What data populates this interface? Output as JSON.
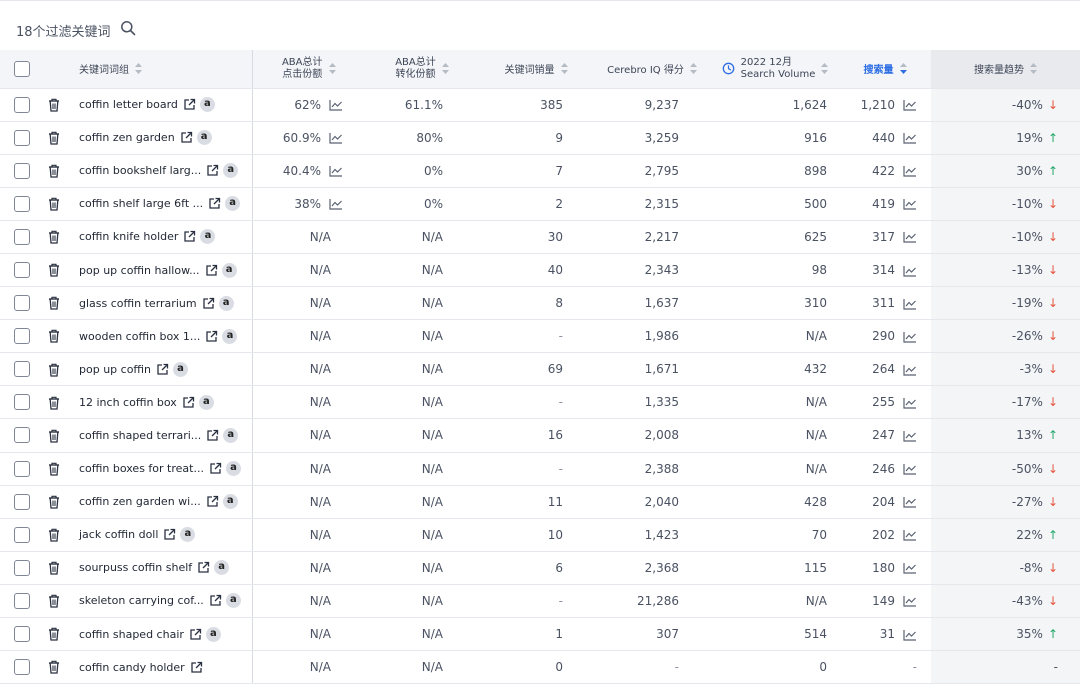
{
  "toolbar": {
    "filter_count_label": "18个过滤关键词"
  },
  "header": {
    "keyword_phrase": "关键词词组",
    "aba_click_line1": "ABA总计",
    "aba_click_line2": "点击份额",
    "aba_conv_line1": "ABA总计",
    "aba_conv_line2": "转化份额",
    "keyword_sales": "关键词销量",
    "cerebro_iq": "Cerebro IQ 得分",
    "sv_line1": "2022 12月",
    "sv_line2": "Search Volume",
    "search_volume": "搜索量",
    "search_trend": "搜索量趋势"
  },
  "colors": {
    "accent": "#2f6fe4",
    "trend_down": "#e5533d",
    "trend_up": "#22a86b",
    "trend_column_bg": "#f4f5f7"
  },
  "rows": [
    {
      "keyword": "coffin letter board",
      "amazon": "a",
      "aba_click": "62%",
      "aba_click_chart": true,
      "aba_conv": "61.1%",
      "sales": "385",
      "iq": "9,237",
      "sv_dec": "1,624",
      "search": "1,210",
      "trend": "-40%",
      "dir": "down"
    },
    {
      "keyword": "coffin zen garden",
      "amazon": "a",
      "aba_click": "60.9%",
      "aba_click_chart": true,
      "aba_conv": "80%",
      "sales": "9",
      "iq": "3,259",
      "sv_dec": "916",
      "search": "440",
      "trend": "19%",
      "dir": "up"
    },
    {
      "keyword": "coffin bookshelf larg...",
      "amazon": "a",
      "aba_click": "40.4%",
      "aba_click_chart": true,
      "aba_conv": "0%",
      "sales": "7",
      "iq": "2,795",
      "sv_dec": "898",
      "search": "422",
      "trend": "30%",
      "dir": "up"
    },
    {
      "keyword": "coffin shelf large 6ft ...",
      "amazon": "a",
      "aba_click": "38%",
      "aba_click_chart": true,
      "aba_conv": "0%",
      "sales": "2",
      "iq": "2,315",
      "sv_dec": "500",
      "search": "419",
      "trend": "-10%",
      "dir": "down"
    },
    {
      "keyword": "coffin knife holder",
      "amazon": "a",
      "aba_click": "N/A",
      "aba_click_chart": false,
      "aba_conv": "N/A",
      "sales": "30",
      "iq": "2,217",
      "sv_dec": "625",
      "search": "317",
      "trend": "-10%",
      "dir": "down"
    },
    {
      "keyword": "pop up coffin hallow...",
      "amazon": "a",
      "aba_click": "N/A",
      "aba_click_chart": false,
      "aba_conv": "N/A",
      "sales": "40",
      "iq": "2,343",
      "sv_dec": "98",
      "search": "314",
      "trend": "-13%",
      "dir": "down"
    },
    {
      "keyword": "glass coffin terrarium",
      "amazon": "a",
      "aba_click": "N/A",
      "aba_click_chart": false,
      "aba_conv": "N/A",
      "sales": "8",
      "iq": "1,637",
      "sv_dec": "310",
      "search": "311",
      "trend": "-19%",
      "dir": "down"
    },
    {
      "keyword": "wooden coffin box 1...",
      "amazon": "a",
      "aba_click": "N/A",
      "aba_click_chart": false,
      "aba_conv": "N/A",
      "sales": "-",
      "iq": "1,986",
      "sv_dec": "N/A",
      "search": "290",
      "trend": "-26%",
      "dir": "down"
    },
    {
      "keyword": "pop up coffin",
      "amazon": "a",
      "aba_click": "N/A",
      "aba_click_chart": false,
      "aba_conv": "N/A",
      "sales": "69",
      "iq": "1,671",
      "sv_dec": "432",
      "search": "264",
      "trend": "-3%",
      "dir": "down"
    },
    {
      "keyword": "12 inch coffin box",
      "amazon": "a",
      "aba_click": "N/A",
      "aba_click_chart": false,
      "aba_conv": "N/A",
      "sales": "-",
      "iq": "1,335",
      "sv_dec": "N/A",
      "search": "255",
      "trend": "-17%",
      "dir": "down"
    },
    {
      "keyword": "coffin shaped terrari...",
      "amazon": "a",
      "aba_click": "N/A",
      "aba_click_chart": false,
      "aba_conv": "N/A",
      "sales": "16",
      "iq": "2,008",
      "sv_dec": "N/A",
      "search": "247",
      "trend": "13%",
      "dir": "up"
    },
    {
      "keyword": "coffin boxes for treat...",
      "amazon": "a",
      "aba_click": "N/A",
      "aba_click_chart": false,
      "aba_conv": "N/A",
      "sales": "-",
      "iq": "2,388",
      "sv_dec": "N/A",
      "search": "246",
      "trend": "-50%",
      "dir": "down"
    },
    {
      "keyword": "coffin zen garden wi...",
      "amazon": "a",
      "aba_click": "N/A",
      "aba_click_chart": false,
      "aba_conv": "N/A",
      "sales": "11",
      "iq": "2,040",
      "sv_dec": "428",
      "search": "204",
      "trend": "-27%",
      "dir": "down"
    },
    {
      "keyword": "jack coffin doll",
      "amazon": "a",
      "aba_click": "N/A",
      "aba_click_chart": false,
      "aba_conv": "N/A",
      "sales": "10",
      "iq": "1,423",
      "sv_dec": "70",
      "search": "202",
      "trend": "22%",
      "dir": "up"
    },
    {
      "keyword": "sourpuss coffin shelf",
      "amazon": "a",
      "aba_click": "N/A",
      "aba_click_chart": false,
      "aba_conv": "N/A",
      "sales": "6",
      "iq": "2,368",
      "sv_dec": "115",
      "search": "180",
      "trend": "-8%",
      "dir": "down"
    },
    {
      "keyword": "skeleton carrying cof...",
      "amazon": "a",
      "aba_click": "N/A",
      "aba_click_chart": false,
      "aba_conv": "N/A",
      "sales": "-",
      "iq": "21,286",
      "sv_dec": "N/A",
      "search": "149",
      "trend": "-43%",
      "dir": "down"
    },
    {
      "keyword": "coffin shaped chair",
      "amazon": "a",
      "aba_click": "N/A",
      "aba_click_chart": false,
      "aba_conv": "N/A",
      "sales": "1",
      "iq": "307",
      "sv_dec": "514",
      "search": "31",
      "trend": "35%",
      "dir": "up"
    },
    {
      "keyword": "coffin candy holder",
      "amazon": "",
      "aba_click": "N/A",
      "aba_click_chart": false,
      "aba_conv": "N/A",
      "sales": "0",
      "iq": "-",
      "sv_dec": "0",
      "search": "-",
      "trend": "-",
      "dir": "none"
    }
  ]
}
